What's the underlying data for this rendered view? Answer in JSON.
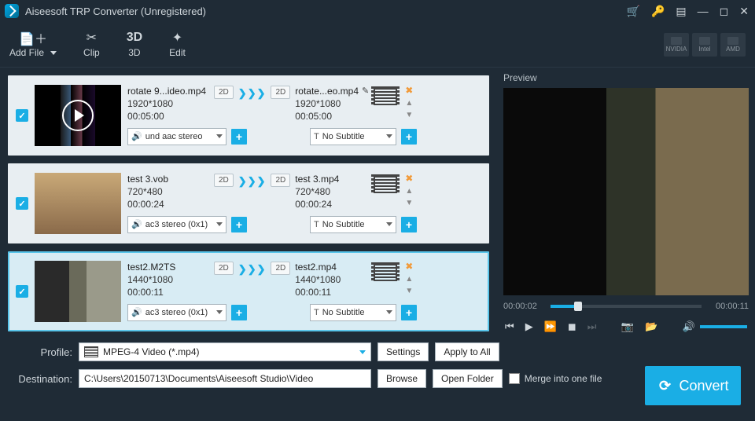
{
  "title": "Aiseesoft TRP Converter (Unregistered)",
  "toolbar": {
    "addfile": "Add File",
    "clip": "Clip",
    "threeD": "3D",
    "edit": "Edit"
  },
  "gpu": [
    "NVIDIA",
    "Intel",
    "AMD"
  ],
  "items": [
    {
      "src_name": "rotate 9...ideo.mp4",
      "src_res": "1920*1080",
      "src_dur": "00:05:00",
      "out_name": "rotate...eo.mp4",
      "out_res": "1920*1080",
      "out_dur": "00:05:00",
      "audio": "und aac stereo",
      "sub": "No Subtitle",
      "badge": "2D",
      "badge2": "2D"
    },
    {
      "src_name": "test 3.vob",
      "src_res": "720*480",
      "src_dur": "00:00:24",
      "out_name": "test 3.mp4",
      "out_res": "720*480",
      "out_dur": "00:00:24",
      "audio": "ac3 stereo (0x1)",
      "sub": "No Subtitle",
      "badge": "2D",
      "badge2": "2D"
    },
    {
      "src_name": "test2.M2TS",
      "src_res": "1440*1080",
      "src_dur": "00:00:11",
      "out_name": "test2.mp4",
      "out_res": "1440*1080",
      "out_dur": "00:00:11",
      "audio": "ac3 stereo (0x1)",
      "sub": "No Subtitle",
      "badge": "2D",
      "badge2": "2D"
    }
  ],
  "preview": {
    "title": "Preview",
    "cur": "00:00:02",
    "total": "00:00:11"
  },
  "profile": {
    "label": "Profile:",
    "value": "MPEG-4 Video (*.mp4)",
    "settings": "Settings",
    "apply": "Apply to All"
  },
  "destination": {
    "label": "Destination:",
    "value": "C:\\Users\\20150713\\Documents\\Aiseesoft Studio\\Video",
    "browse": "Browse",
    "open": "Open Folder"
  },
  "merge": "Merge into one file",
  "convert": "Convert",
  "arrows": "❯❯❯"
}
